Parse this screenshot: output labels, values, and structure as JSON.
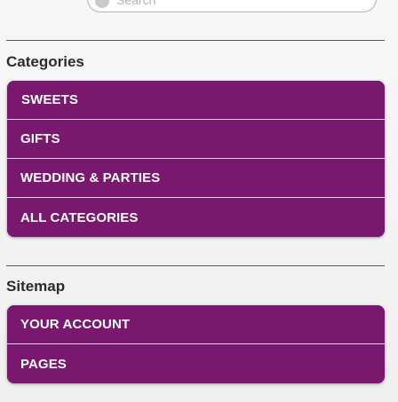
{
  "search": {
    "placeholder": "Search",
    "value": ""
  },
  "categories": {
    "heading": "Categories",
    "items": [
      {
        "label": "SWEETS"
      },
      {
        "label": "GIFTS"
      },
      {
        "label": "WEDDING & PARTIES"
      },
      {
        "label": "ALL CATEGORIES"
      }
    ]
  },
  "sitemap": {
    "heading": "Sitemap",
    "items": [
      {
        "label": "YOUR ACCOUNT"
      },
      {
        "label": "PAGES"
      }
    ]
  },
  "colors": {
    "list_background": "#7a176e",
    "list_text": "#ffffff",
    "heading_text": "#2b2b2b",
    "divider": "#5a5a5a"
  }
}
